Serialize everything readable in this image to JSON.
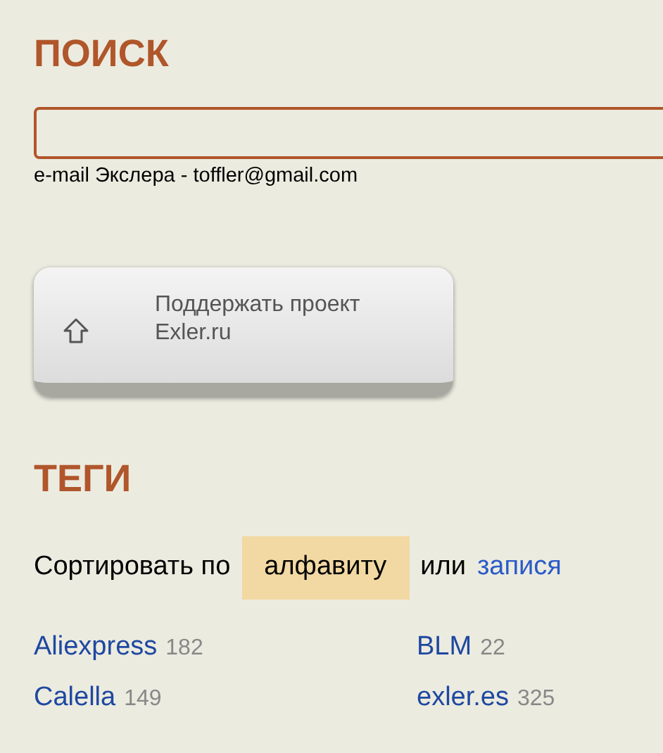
{
  "search": {
    "title": "ПОИСК",
    "note": "e-mail Экслера - toffler@gmail.com"
  },
  "support_button": {
    "label_line_1": "Поддержать проект",
    "label_line_2": "Exler.ru"
  },
  "tags": {
    "title": "ТЕГИ",
    "sort_prefix": "Сортировать по",
    "sort_options": [
      {
        "label": "алфавиту",
        "selected": true
      },
      {
        "label": "запися",
        "selected": false
      }
    ],
    "sort_separator": "или",
    "items": [
      {
        "name": "Aliexpress",
        "count": "182"
      },
      {
        "name": "BLM",
        "count": "22"
      },
      {
        "name": "Calella",
        "count": "149"
      },
      {
        "name": "exler.es",
        "count": "325"
      }
    ]
  }
}
